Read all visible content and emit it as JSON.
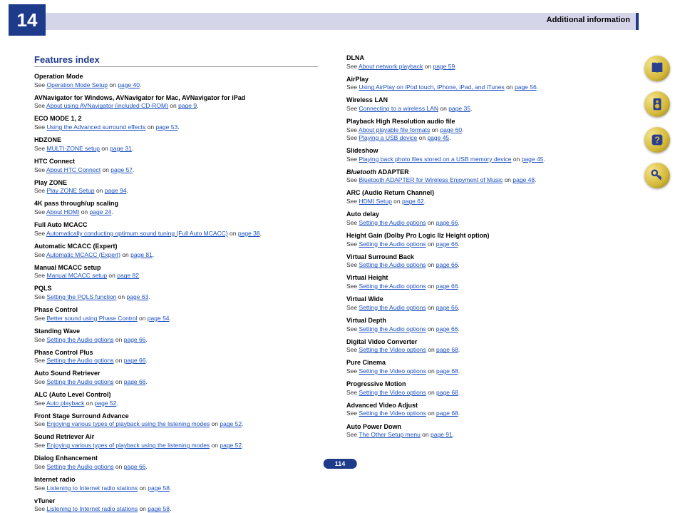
{
  "chapter": "14",
  "headerTitle": "Additional information",
  "pageNumber": "114",
  "sectionTitle": "Features index",
  "col1": [
    {
      "title": "Operation Mode",
      "lines": [
        {
          "pre": "See ",
          "link": "Operation Mode Setup",
          "mid": " on ",
          "page": "page 40",
          "post": "."
        }
      ]
    },
    {
      "title": "AVNavigator for Windows, AVNavigator for Mac, AVNavigator for iPad",
      "lines": [
        {
          "pre": "See ",
          "link": "About using AVNavigator (included CD-ROM)",
          "mid": " on ",
          "page": "page 9",
          "post": "."
        }
      ]
    },
    {
      "title": "ECO MODE 1, 2",
      "lines": [
        {
          "pre": "See ",
          "link": "Using the Advanced surround effects",
          "mid": " on ",
          "page": "page 53",
          "post": "."
        }
      ]
    },
    {
      "title": "HDZONE",
      "lines": [
        {
          "pre": "See ",
          "link": "MULTI-ZONE setup",
          "mid": " on ",
          "page": "page 31",
          "post": "."
        }
      ]
    },
    {
      "title": "HTC Connect",
      "lines": [
        {
          "pre": "See ",
          "link": "About HTC Connect",
          "mid": " on ",
          "page": "page 57",
          "post": "."
        }
      ]
    },
    {
      "title": "Play ZONE",
      "lines": [
        {
          "pre": "See ",
          "link": "Play ZONE Setup",
          "mid": " on ",
          "page": "page 94",
          "post": "."
        }
      ]
    },
    {
      "title": "4K pass through/up scaling",
      "lines": [
        {
          "pre": "See ",
          "link": "About HDMI",
          "mid": " on ",
          "page": "page 24",
          "post": "."
        }
      ]
    },
    {
      "title": "Full Auto MCACC",
      "lines": [
        {
          "pre": "See ",
          "link": "Automatically conducting optimum sound tuning (Full Auto MCACC)",
          "mid": " on ",
          "page": "page 38",
          "post": "."
        }
      ]
    },
    {
      "title": "Automatic MCACC (Expert)",
      "lines": [
        {
          "pre": "See ",
          "link": "Automatic MCACC (Expert)",
          "mid": " on ",
          "page": "page 81",
          "post": "."
        }
      ]
    },
    {
      "title": "Manual MCACC setup",
      "lines": [
        {
          "pre": "See ",
          "link": "Manual MCACC setup",
          "mid": " on ",
          "page": "page 82",
          "post": "."
        }
      ]
    },
    {
      "title": "PQLS",
      "lines": [
        {
          "pre": "See ",
          "link": "Setting the PQLS function",
          "mid": " on ",
          "page": "page 63",
          "post": "."
        }
      ]
    },
    {
      "title": "Phase Control",
      "lines": [
        {
          "pre": "See ",
          "link": "Better sound using Phase Control",
          "mid": " on ",
          "page": "page 54",
          "post": "."
        }
      ]
    },
    {
      "title": "Standing Wave",
      "lines": [
        {
          "pre": "See ",
          "link": "Setting the Audio options",
          "mid": " on ",
          "page": "page 66",
          "post": "."
        }
      ]
    },
    {
      "title": "Phase Control Plus",
      "lines": [
        {
          "pre": "See ",
          "link": "Setting the Audio options",
          "mid": " on ",
          "page": "page 66",
          "post": "."
        }
      ]
    },
    {
      "title": "Auto Sound Retriever",
      "lines": [
        {
          "pre": "See ",
          "link": "Setting the Audio options",
          "mid": " on ",
          "page": "page 66",
          "post": "."
        }
      ]
    },
    {
      "title": "ALC (Auto Level Control)",
      "lines": [
        {
          "pre": "See ",
          "link": "Auto playback",
          "mid": " on ",
          "page": "page 52",
          "post": "."
        }
      ]
    },
    {
      "title": "Front Stage Surround Advance",
      "lines": [
        {
          "pre": "See ",
          "link": "Enjoying various types of playback using the listening modes",
          "mid": " on ",
          "page": "page 52",
          "post": "."
        }
      ]
    },
    {
      "title": "Sound Retriever Air",
      "lines": [
        {
          "pre": "See ",
          "link": "Enjoying various types of playback using the listening modes",
          "mid": " on ",
          "page": "page 52",
          "post": "."
        }
      ]
    },
    {
      "title": "Dialog Enhancement",
      "lines": [
        {
          "pre": "See ",
          "link": "Setting the Audio options",
          "mid": " on ",
          "page": "page 66",
          "post": "."
        }
      ]
    },
    {
      "title": "Internet radio",
      "lines": [
        {
          "pre": "See ",
          "link": "Listening to Internet radio stations",
          "mid": " on ",
          "page": "page 58",
          "post": "."
        }
      ]
    },
    {
      "title": "vTuner",
      "lines": [
        {
          "pre": "See ",
          "link": "Listening to Internet radio stations",
          "mid": " on ",
          "page": "page 58",
          "post": "."
        }
      ]
    }
  ],
  "col2": [
    {
      "title": "DLNA",
      "lines": [
        {
          "pre": "See ",
          "link": "About network playback",
          "mid": " on ",
          "page": "page 59",
          "post": "."
        }
      ]
    },
    {
      "title": "AirPlay",
      "lines": [
        {
          "pre": "See ",
          "link": "Using AirPlay on iPod touch, iPhone, iPad, and iTunes",
          "mid": " on ",
          "page": "page 56",
          "post": "."
        }
      ]
    },
    {
      "title": "Wireless LAN",
      "lines": [
        {
          "pre": "See ",
          "link": "Connecting to a wireless LAN",
          "mid": " on ",
          "page": "page 35",
          "post": "."
        }
      ]
    },
    {
      "title": "Playback High Resolution audio file",
      "lines": [
        {
          "pre": "See ",
          "link": "About playable file formats",
          "mid": " on ",
          "page": "page 60",
          "post": "."
        },
        {
          "pre": "See ",
          "link": "Playing a USB device",
          "mid": " on ",
          "page": "page 45",
          "post": "."
        }
      ]
    },
    {
      "title": "Slideshow",
      "lines": [
        {
          "pre": "See ",
          "link": "Playing back photo files stored on a USB memory device",
          "mid": " on ",
          "page": "page 45",
          "post": "."
        }
      ]
    },
    {
      "title": "<em>Bluetooth</em> ADAPTER",
      "lines": [
        {
          "pre": "See ",
          "link": "Bluetooth ADAPTER for Wireless Enjoyment of Music",
          "mid": " on ",
          "page": "page 48",
          "post": "."
        }
      ]
    },
    {
      "title": "ARC (Audio Return Channel)",
      "lines": [
        {
          "pre": "See ",
          "link": "HDMI Setup",
          "mid": " on ",
          "page": "page 62",
          "post": "."
        }
      ]
    },
    {
      "title": "Auto delay",
      "lines": [
        {
          "pre": "See ",
          "link": "Setting the Audio options",
          "mid": " on ",
          "page": "page 66",
          "post": "."
        }
      ]
    },
    {
      "title": "Height Gain (Dolby Pro Logic llz Height option)",
      "lines": [
        {
          "pre": "See ",
          "link": "Setting the Audio options",
          "mid": " on ",
          "page": "page 66",
          "post": "."
        }
      ]
    },
    {
      "title": "Virtual Surround Back",
      "lines": [
        {
          "pre": "See ",
          "link": "Setting the Audio options",
          "mid": " on ",
          "page": "page 66",
          "post": "."
        }
      ]
    },
    {
      "title": "Virtual Height",
      "lines": [
        {
          "pre": "See ",
          "link": "Setting the Audio options",
          "mid": " on ",
          "page": "page 66",
          "post": "."
        }
      ]
    },
    {
      "title": "Virtual Wide",
      "lines": [
        {
          "pre": "See ",
          "link": "Setting the Audio options",
          "mid": " on ",
          "page": "page 66",
          "post": "."
        }
      ]
    },
    {
      "title": "Virtual Depth",
      "lines": [
        {
          "pre": "See ",
          "link": "Setting the Audio options",
          "mid": " on ",
          "page": "page 66",
          "post": "."
        }
      ]
    },
    {
      "title": "Digital Video Converter",
      "lines": [
        {
          "pre": "See ",
          "link": "Setting the Video options",
          "mid": " on ",
          "page": "page 68",
          "post": "."
        }
      ]
    },
    {
      "title": "Pure Cinema",
      "lines": [
        {
          "pre": "See ",
          "link": "Setting the Video options",
          "mid": " on ",
          "page": "page 68",
          "post": "."
        }
      ]
    },
    {
      "title": "Progressive Motion",
      "lines": [
        {
          "pre": "See ",
          "link": "Setting the Video options",
          "mid": " on ",
          "page": "page 68",
          "post": "."
        }
      ]
    },
    {
      "title": "Advanced Video Adjust",
      "lines": [
        {
          "pre": "See ",
          "link": "Setting the Video options",
          "mid": " on ",
          "page": "page 68",
          "post": "."
        }
      ]
    },
    {
      "title": "Auto Power Down",
      "lines": [
        {
          "pre": "See ",
          "link": "The Other Setup menu",
          "mid": " on ",
          "page": "page 91",
          "post": "."
        }
      ]
    }
  ],
  "icons": [
    "book-icon",
    "speaker-icon",
    "help-icon",
    "key-icon"
  ]
}
